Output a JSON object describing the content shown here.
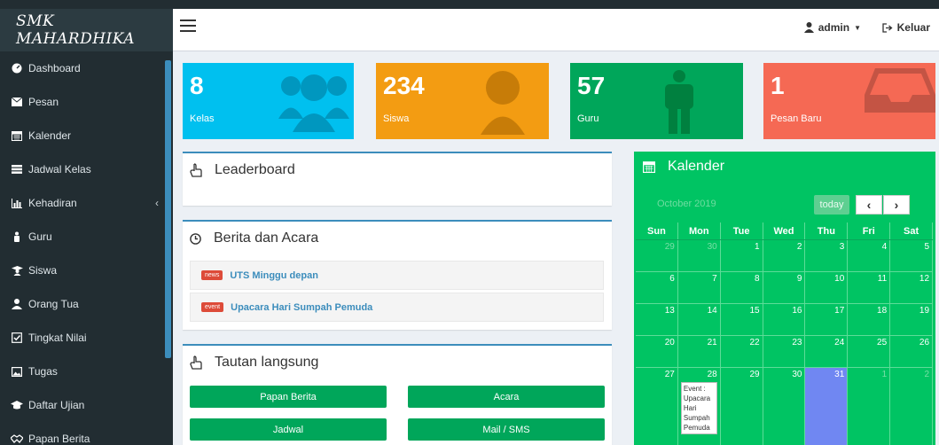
{
  "brand": "SMK MAHARDHIKA",
  "header": {
    "user": "admin",
    "logout": "Keluar"
  },
  "sidebar": {
    "items": [
      {
        "label": "Dashboard",
        "icon": "dashboard-icon"
      },
      {
        "label": "Pesan",
        "icon": "envelope-icon"
      },
      {
        "label": "Kalender",
        "icon": "calendar-icon"
      },
      {
        "label": "Jadwal Kelas",
        "icon": "list-icon"
      },
      {
        "label": "Kehadiran",
        "icon": "bar-chart-icon"
      },
      {
        "label": "Guru",
        "icon": "guru-icon"
      },
      {
        "label": "Siswa",
        "icon": "users-icon"
      },
      {
        "label": "Orang Tua",
        "icon": "user-icon"
      },
      {
        "label": "Tingkat Nilai",
        "icon": "check-square-icon"
      },
      {
        "label": "Tugas",
        "icon": "image-icon"
      },
      {
        "label": "Daftar Ujian",
        "icon": "graduation-cap-icon"
      },
      {
        "label": "Papan Berita",
        "icon": "handshake-icon"
      }
    ]
  },
  "stats": [
    {
      "value": "8",
      "label": "Kelas",
      "color": "#00c0ef"
    },
    {
      "value": "234",
      "label": "Siswa",
      "color": "#f39c12"
    },
    {
      "value": "57",
      "label": "Guru",
      "color": "#00a65a"
    },
    {
      "value": "1",
      "label": "Pesan Baru",
      "color": "#f56954"
    }
  ],
  "leaderboard": {
    "title": "Leaderboard"
  },
  "news": {
    "title": "Berita dan Acara",
    "items": [
      {
        "badge": "news",
        "text": "UTS Minggu depan"
      },
      {
        "badge": "event",
        "text": "Upacara Hari Sumpah Pemuda"
      }
    ]
  },
  "links": {
    "title": "Tautan langsung",
    "buttons": [
      "Papan Berita",
      "Acara",
      "Jadwal",
      "Mail / SMS"
    ]
  },
  "calendar": {
    "title": "Kalender",
    "month": "October 2019",
    "today_label": "today",
    "days": [
      "Sun",
      "Mon",
      "Tue",
      "Wed",
      "Thu",
      "Fri",
      "Sat"
    ],
    "weeks": [
      [
        "29",
        "30",
        "1",
        "2",
        "3",
        "4",
        "5"
      ],
      [
        "6",
        "7",
        "8",
        "9",
        "10",
        "11",
        "12"
      ],
      [
        "13",
        "14",
        "15",
        "16",
        "17",
        "18",
        "19"
      ],
      [
        "20",
        "21",
        "22",
        "23",
        "24",
        "25",
        "26"
      ],
      [
        "27",
        "28",
        "29",
        "30",
        "31",
        "1",
        "2"
      ]
    ],
    "event_text": "Event : Upacara Hari Sumpah Pemuda",
    "accent": "#00c463"
  }
}
